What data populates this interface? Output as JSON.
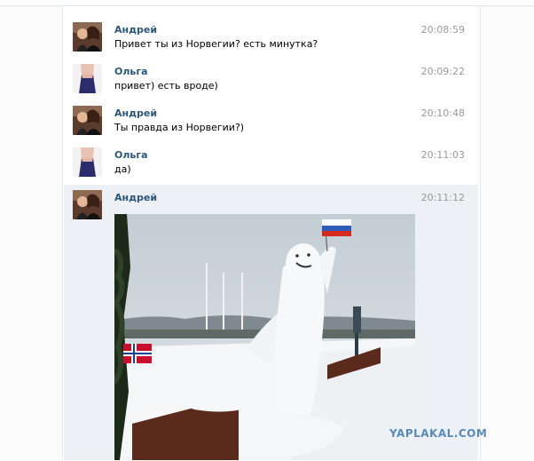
{
  "messages": [
    {
      "author": "Андрей",
      "text": "Привет ты из Норвегии? есть минутка?",
      "time": "20:08:59",
      "avatar": "avatar-andrey"
    },
    {
      "author": "Ольга",
      "text": "привет) есть вроде)",
      "time": "20:09:22",
      "avatar": "avatar-olga"
    },
    {
      "author": "Андрей",
      "text": "Ты правда из Норвегии?)",
      "time": "20:10:48",
      "avatar": "avatar-andrey"
    },
    {
      "author": "Ольга",
      "text": "да)",
      "time": "20:11:03",
      "avatar": "avatar-olga"
    },
    {
      "author": "Андрей",
      "text": "",
      "time": "20:11:12",
      "avatar": "avatar-andrey"
    }
  ],
  "watermark": "YAPLAKAL.COM",
  "colors": {
    "author": "#2b587a",
    "time": "#999999",
    "highlight": "#edf1f5"
  }
}
